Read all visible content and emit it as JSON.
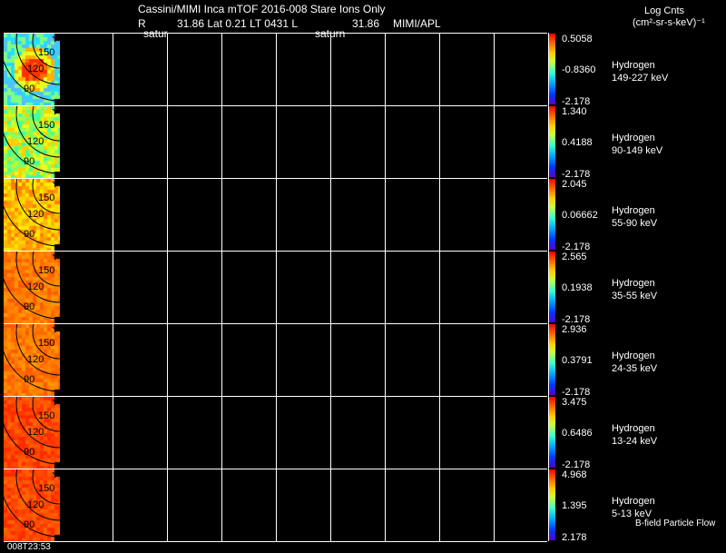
{
  "header": {
    "title": "Cassini/MIMI Inca mTOF  2016-008   Stare   Ions Only",
    "line2_prefix": "R",
    "line2_values": "31.86 Lat 0.21 LT 0431 L",
    "line2_lvalue": "31.86",
    "line2_suffix": "MIMI/APL",
    "sub_left": "satur",
    "sub_right": "saturn",
    "units_title": "Log Cnts",
    "units_formula": "(cm²-sr-s-keV)⁻¹"
  },
  "footer": {
    "timestamp": "008T23:53",
    "legend_note": "B-field Particle Flow"
  },
  "contour_labels": [
    "150",
    "120",
    "90"
  ],
  "panels": [
    {
      "species": "Hydrogen",
      "range": "149-227 keV",
      "cb_max": "0.5058",
      "cb_mid": "-0.8360",
      "cb_min": "-2.178",
      "palette": "cyan"
    },
    {
      "species": "Hydrogen",
      "range": "90-149 keV",
      "cb_max": "1.340",
      "cb_mid": "0.4188",
      "cb_min": "-2.178",
      "palette": "green"
    },
    {
      "species": "Hydrogen",
      "range": "55-90 keV",
      "cb_max": "2.045",
      "cb_mid": "0.06662",
      "cb_min": "-2.178",
      "palette": "yellow"
    },
    {
      "species": "Hydrogen",
      "range": "35-55 keV",
      "cb_max": "2.565",
      "cb_mid": "0.1938",
      "cb_min": "-2.178",
      "palette": "orange"
    },
    {
      "species": "Hydrogen",
      "range": "24-35 keV",
      "cb_max": "2.936",
      "cb_mid": "0.3791",
      "cb_min": "-2.178",
      "palette": "orange"
    },
    {
      "species": "Hydrogen",
      "range": "13-24 keV",
      "cb_max": "3.475",
      "cb_mid": "0.6486",
      "cb_min": "-2.178",
      "palette": "red"
    },
    {
      "species": "Hydrogen",
      "range": "5-13 keV",
      "cb_max": "4.968",
      "cb_mid": "1.395",
      "cb_min": "2.178",
      "palette": "red"
    }
  ]
}
